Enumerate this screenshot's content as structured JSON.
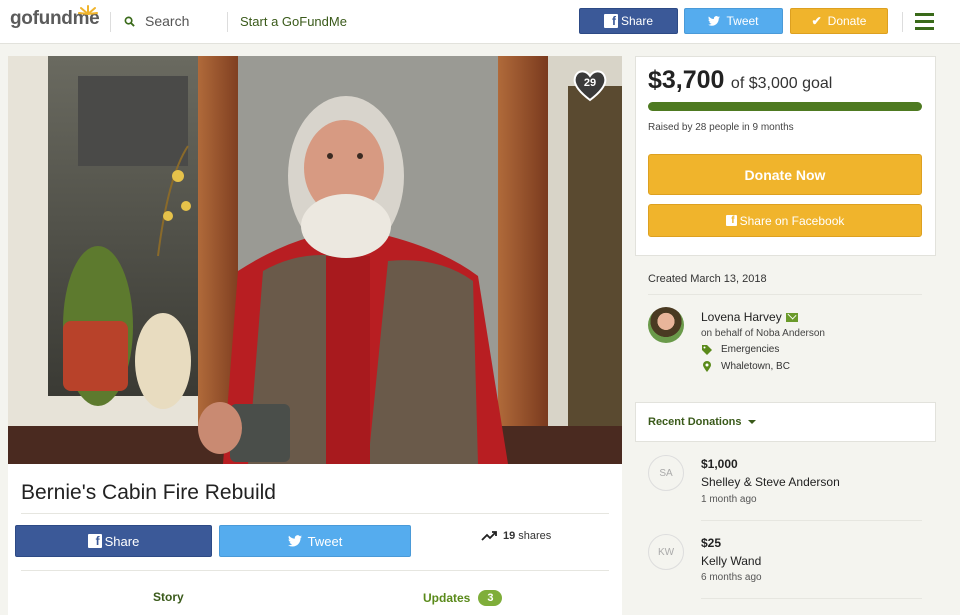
{
  "header": {
    "logo_go": "go",
    "logo_fund": "fund",
    "logo_me": "me",
    "search_label": "Search",
    "start_label": "Start a GoFundMe",
    "share_label": "Share",
    "tweet_label": "Tweet",
    "donate_label": "Donate"
  },
  "campaign": {
    "title": "Bernie's Cabin Fire Rebuild",
    "hearts": "29",
    "share_label": "Share",
    "tweet_label": "Tweet",
    "shares_count": "19",
    "shares_word": "shares",
    "tabs": {
      "story": "Story",
      "updates": "Updates",
      "updates_count": "3"
    }
  },
  "summary": {
    "raised": "$3,700",
    "goal_text": "of $3,000 goal",
    "progress_fraction": 1.0,
    "raised_by": "Raised by 28 people in 9 months",
    "donate_now": "Donate Now",
    "share_facebook": "Share on Facebook"
  },
  "details": {
    "created": "Created March 13, 2018",
    "organizer": "Lovena Harvey",
    "on_behalf": "on behalf of Noba Anderson",
    "category": "Emergencies",
    "location": "Whaletown, BC"
  },
  "recent": {
    "header": "Recent Donations",
    "donations": [
      {
        "initials": "SA",
        "amount": "$1,000",
        "name": "Shelley & Steve Anderson",
        "time": "1 month ago"
      },
      {
        "initials": "KW",
        "amount": "$25",
        "name": "Kelly Wand",
        "time": "6 months ago"
      }
    ]
  },
  "colors": {
    "brand_green": "#4e7a21",
    "facebook": "#3b5998",
    "twitter": "#55acee",
    "donate": "#f0b42c"
  },
  "icons": [
    "search-icon",
    "facebook-icon",
    "twitter-icon",
    "check-icon",
    "hamburger-icon",
    "heart-icon",
    "trending-icon",
    "envelope-icon",
    "tag-icon",
    "map-pin-icon",
    "caret-down-icon"
  ]
}
